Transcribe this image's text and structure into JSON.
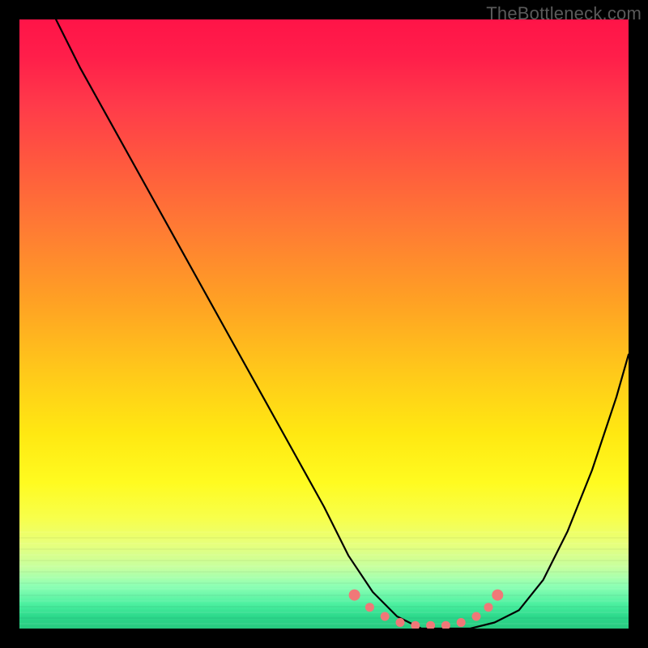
{
  "watermark": {
    "text": "TheBottleneck.com"
  },
  "chart_data": {
    "type": "line",
    "title": "",
    "xlabel": "",
    "ylabel": "",
    "xlim": [
      0,
      100
    ],
    "ylim": [
      0,
      100
    ],
    "grid": false,
    "legend": false,
    "series": [
      {
        "name": "bottleneck-curve",
        "x": [
          6,
          10,
          15,
          20,
          25,
          30,
          35,
          40,
          45,
          50,
          54,
          58,
          62,
          66,
          70,
          74,
          78,
          82,
          86,
          90,
          94,
          98,
          100
        ],
        "values": [
          100,
          92,
          83,
          74,
          65,
          56,
          47,
          38,
          29,
          20,
          12,
          6,
          2,
          0,
          0,
          0,
          1,
          3,
          8,
          16,
          26,
          38,
          45
        ]
      }
    ],
    "markers": {
      "name": "min-region-dots",
      "color": "#f07878",
      "x": [
        55,
        57.5,
        60,
        62.5,
        65,
        67.5,
        70,
        72.5,
        75,
        77,
        78.5
      ],
      "values": [
        5.5,
        3.5,
        2,
        1,
        0.5,
        0.5,
        0.5,
        1,
        2,
        3.5,
        5.5
      ]
    },
    "background_gradient": {
      "type": "vertical",
      "stops": [
        {
          "pos": 0.0,
          "color": "#ff1448"
        },
        {
          "pos": 0.5,
          "color": "#ffc91a"
        },
        {
          "pos": 0.78,
          "color": "#fffb20"
        },
        {
          "pos": 1.0,
          "color": "#27c97f"
        }
      ]
    }
  }
}
